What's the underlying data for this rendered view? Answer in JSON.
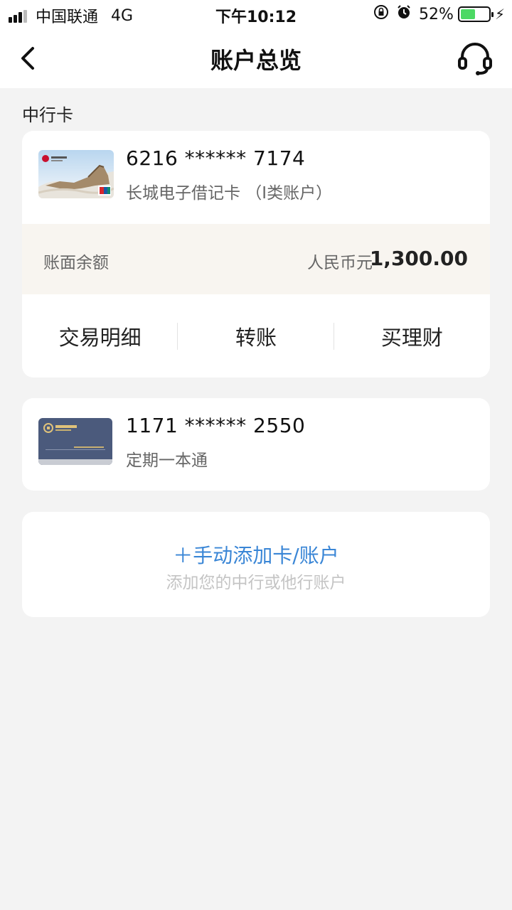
{
  "status_bar": {
    "carrier": "中国联通",
    "network": "4G",
    "time": "下午10:12",
    "battery_percent": "52%",
    "battery_level": 0.52,
    "battery_color": "#4cd964"
  },
  "nav": {
    "title": "账户总览",
    "back_icon": "chevron-left-icon",
    "service_icon": "headset-icon"
  },
  "section": {
    "label": "中行卡"
  },
  "accounts": [
    {
      "number": "6216 ****** 7174",
      "type": "长城电子借记卡 （I类账户）",
      "balance_label": "账面余额",
      "currency": "人民币元",
      "balance": "1,300.00",
      "actions": [
        "交易明细",
        "转账",
        "买理财"
      ]
    },
    {
      "number": "1171 ****** 2550",
      "type": "定期一本通"
    }
  ],
  "add_account": {
    "label": "＋手动添加卡/账户",
    "sublabel": "添加您的中行或他行账户",
    "accent": "#3a86d6"
  }
}
